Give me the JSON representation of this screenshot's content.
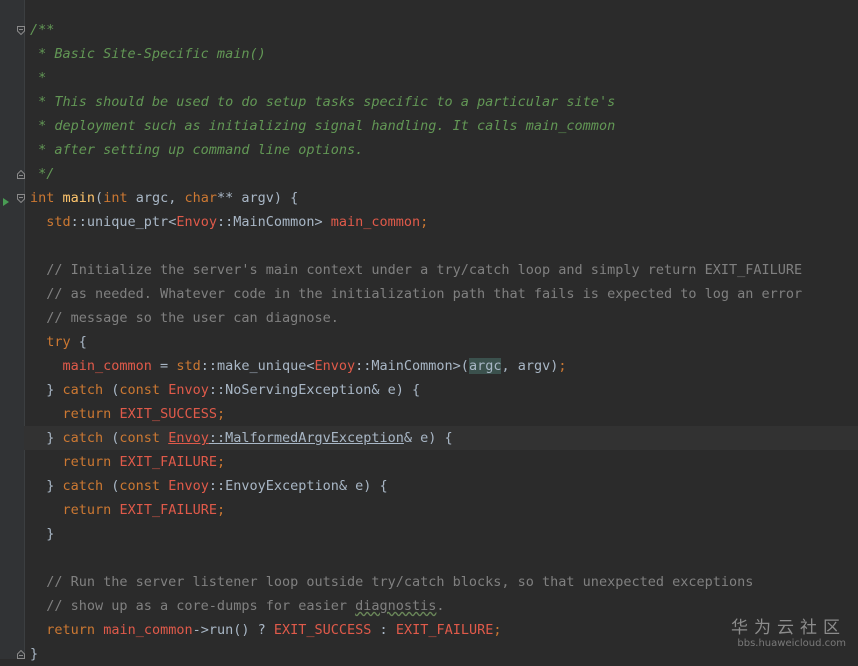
{
  "editor": {
    "lines": [
      {
        "tokens": [
          {
            "t": "/**",
            "c": "doc"
          }
        ]
      },
      {
        "tokens": [
          {
            "t": " * Basic Site-Specific main()",
            "c": "doc"
          }
        ]
      },
      {
        "tokens": [
          {
            "t": " *",
            "c": "doc"
          }
        ]
      },
      {
        "tokens": [
          {
            "t": " * This should be used to do setup tasks specific to a particular site's",
            "c": "doc"
          }
        ]
      },
      {
        "tokens": [
          {
            "t": " * deployment such as initializing signal handling. It calls main_common",
            "c": "doc"
          }
        ]
      },
      {
        "tokens": [
          {
            "t": " * after setting up command line options.",
            "c": "doc"
          }
        ]
      },
      {
        "tokens": [
          {
            "t": " */",
            "c": "doc"
          }
        ]
      },
      {
        "tokens": [
          {
            "t": "int",
            "c": "kw"
          },
          {
            "t": " ",
            "c": "op"
          },
          {
            "t": "main",
            "c": "fn"
          },
          {
            "t": "(",
            "c": "op"
          },
          {
            "t": "int",
            "c": "kw"
          },
          {
            "t": " argc, ",
            "c": "op"
          },
          {
            "t": "char",
            "c": "kw"
          },
          {
            "t": "** argv) {",
            "c": "op"
          }
        ]
      },
      {
        "tokens": [
          {
            "t": "  ",
            "c": "op"
          },
          {
            "t": "std",
            "c": "ns"
          },
          {
            "t": "::unique_ptr<",
            "c": "op"
          },
          {
            "t": "Envoy",
            "c": "var"
          },
          {
            "t": "::MainCommon> ",
            "c": "op"
          },
          {
            "t": "main_common",
            "c": "var"
          },
          {
            "t": ";",
            "c": "kw"
          }
        ]
      },
      {
        "tokens": [
          {
            "t": "",
            "c": "op"
          }
        ]
      },
      {
        "tokens": [
          {
            "t": "  // Initialize the server's main context under a try/catch loop and simply return EXIT_FAILURE",
            "c": "cmt"
          }
        ]
      },
      {
        "tokens": [
          {
            "t": "  // as needed. Whatever code in the initialization path that fails is expected to log an error",
            "c": "cmt"
          }
        ]
      },
      {
        "tokens": [
          {
            "t": "  // message so the user can diagnose.",
            "c": "cmt"
          }
        ]
      },
      {
        "tokens": [
          {
            "t": "  ",
            "c": "op"
          },
          {
            "t": "try",
            "c": "kw"
          },
          {
            "t": " {",
            "c": "op"
          }
        ]
      },
      {
        "tokens": [
          {
            "t": "    ",
            "c": "op"
          },
          {
            "t": "main_common",
            "c": "var"
          },
          {
            "t": " = ",
            "c": "op"
          },
          {
            "t": "std",
            "c": "ns"
          },
          {
            "t": "::make_unique<",
            "c": "op"
          },
          {
            "t": "Envoy",
            "c": "var"
          },
          {
            "t": "::MainCommon>(",
            "c": "op"
          },
          {
            "t": "argc",
            "c": "hl"
          },
          {
            "t": ", argv)",
            "c": "op"
          },
          {
            "t": ";",
            "c": "kw"
          }
        ]
      },
      {
        "tokens": [
          {
            "t": "  } ",
            "c": "op"
          },
          {
            "t": "catch",
            "c": "kw"
          },
          {
            "t": " (",
            "c": "op"
          },
          {
            "t": "const",
            "c": "kw"
          },
          {
            "t": " ",
            "c": "op"
          },
          {
            "t": "Envoy",
            "c": "var"
          },
          {
            "t": "::NoServingException& e) {",
            "c": "op"
          }
        ]
      },
      {
        "tokens": [
          {
            "t": "    ",
            "c": "op"
          },
          {
            "t": "return",
            "c": "kw"
          },
          {
            "t": " ",
            "c": "op"
          },
          {
            "t": "EXIT_SUCCESS",
            "c": "var"
          },
          {
            "t": ";",
            "c": "kw"
          }
        ]
      },
      {
        "tokens": [
          {
            "t": "  } ",
            "c": "op"
          },
          {
            "t": "catch",
            "c": "kw"
          },
          {
            "t": " (",
            "c": "op"
          },
          {
            "t": "const",
            "c": "kw"
          },
          {
            "t": " ",
            "c": "op"
          },
          {
            "t": "Envoy",
            "c": "var u"
          },
          {
            "t": "::",
            "c": "op u"
          },
          {
            "t": "MalformedArgvException",
            "c": "op u"
          },
          {
            "t": "& e) {",
            "c": "op"
          }
        ],
        "current": true
      },
      {
        "tokens": [
          {
            "t": "    ",
            "c": "op"
          },
          {
            "t": "return",
            "c": "kw"
          },
          {
            "t": " ",
            "c": "op"
          },
          {
            "t": "EXIT_FAILURE",
            "c": "var"
          },
          {
            "t": ";",
            "c": "kw"
          }
        ]
      },
      {
        "tokens": [
          {
            "t": "  } ",
            "c": "op"
          },
          {
            "t": "catch",
            "c": "kw"
          },
          {
            "t": " (",
            "c": "op"
          },
          {
            "t": "const",
            "c": "kw"
          },
          {
            "t": " ",
            "c": "op"
          },
          {
            "t": "Envoy",
            "c": "var"
          },
          {
            "t": "::EnvoyException& e) {",
            "c": "op"
          }
        ]
      },
      {
        "tokens": [
          {
            "t": "    ",
            "c": "op"
          },
          {
            "t": "return",
            "c": "kw"
          },
          {
            "t": " ",
            "c": "op"
          },
          {
            "t": "EXIT_FAILURE",
            "c": "var"
          },
          {
            "t": ";",
            "c": "kw"
          }
        ]
      },
      {
        "tokens": [
          {
            "t": "  }",
            "c": "op"
          }
        ]
      },
      {
        "tokens": [
          {
            "t": "",
            "c": "op"
          }
        ]
      },
      {
        "tokens": [
          {
            "t": "  // Run the server listener loop outside try/catch blocks, so that unexpected exceptions",
            "c": "cmt"
          }
        ]
      },
      {
        "tokens": [
          {
            "t": "  // show up as a core-dumps for easier ",
            "c": "cmt"
          },
          {
            "t": "diagnostis",
            "c": "cmt squig"
          },
          {
            "t": ".",
            "c": "cmt"
          }
        ]
      },
      {
        "tokens": [
          {
            "t": "  ",
            "c": "op"
          },
          {
            "t": "return",
            "c": "kw"
          },
          {
            "t": " ",
            "c": "op"
          },
          {
            "t": "main_common",
            "c": "var"
          },
          {
            "t": "->run() ? ",
            "c": "op"
          },
          {
            "t": "EXIT_SUCCESS",
            "c": "var"
          },
          {
            "t": " : ",
            "c": "op"
          },
          {
            "t": "EXIT_FAILURE",
            "c": "var"
          },
          {
            "t": ";",
            "c": "kw"
          }
        ]
      },
      {
        "tokens": [
          {
            "t": "}",
            "c": "op"
          }
        ]
      }
    ]
  },
  "watermark": {
    "title": "华为云社区",
    "url": "bbs.huaweicloud.com"
  }
}
